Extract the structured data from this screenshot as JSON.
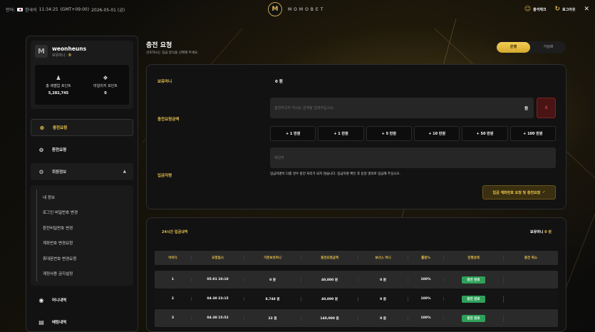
{
  "topbar": {
    "lang_label": "언어:",
    "lang": "한국어",
    "time": "11:34:25",
    "timezone": "(GMT+09:00)",
    "date": "2026-05-01 (금)",
    "logo_letter": "M",
    "brand": "MOMOBET",
    "attendance": "출석체크",
    "logout": "로그아웃",
    "close": "✕"
  },
  "profile": {
    "avatar": "M",
    "username": "weonheuns",
    "level_label": "보유머니 :",
    "level_value": "0",
    "points": [
      {
        "label": "총 레벨업 포인트",
        "value": "5,282,745",
        "icon": "person-icon"
      },
      {
        "label": "마일리지 포인트",
        "value": "0",
        "icon": "mileage-icon"
      }
    ]
  },
  "menu": {
    "deposit": "충전요청",
    "withdraw": "환전요청",
    "member_info": "회원정보",
    "sub": [
      "내 정보",
      "로그인 비밀번호 변경",
      "환전비밀번호 변경",
      "계좌번호 변경요청",
      "휴대폰번호 변경요청",
      "계정사용 금지설정"
    ],
    "money_history": "머니내역",
    "betting_history": "베팅내역"
  },
  "page": {
    "title": "충전 요청",
    "subtitle": "선호하시는 입금 방식을 선택해 주세요.",
    "toggle_on": "은행",
    "toggle_off": "가상화"
  },
  "form": {
    "balance_label": "보유머니",
    "balance_value": "0 원",
    "amount_label": "충전요청금액",
    "amount_placeholder": "충전하고자 하시는 금액을 입력하십시오.",
    "won": "원",
    "clear": "X",
    "amounts": [
      "+ 1 만원",
      "+ 1 만원",
      "+ 5 만원",
      "+ 10 만원",
      "+ 50 만원",
      "+ 100 만원"
    ],
    "depositor_label": "입금자명",
    "depositor_placeholder": "예금주",
    "note": "입금자명이 다를 경우 충전 처리가 되지 않습니다. 입금자명 확인 후 동일 명의로 입금해 주십시오.",
    "submit": "입금 계좌번호 요청 및 충전요청",
    "submit_icon": "✓"
  },
  "history": {
    "title": "24시간 입금내역",
    "balance_label": "보유머니",
    "balance_value": "0 원",
    "headers": [
      "아이디",
      "요청일시",
      "기존보유머니",
      "충전요청금액",
      "보너스 머니",
      "롤링%",
      "진행상태",
      "충전 취소"
    ],
    "rows": [
      {
        "id": "1",
        "date": "05-01 10:10",
        "prev": "0 원",
        "amount": "40,000 원",
        "bonus": "0 원",
        "rolling": "100%",
        "status": "충전 완료",
        "cancel": ""
      },
      {
        "id": "2",
        "date": "04-30 23:15",
        "prev": "8,748 원",
        "amount": "40,000 원",
        "bonus": "0 원",
        "rolling": "100%",
        "status": "충전 완료",
        "cancel": ""
      },
      {
        "id": "3",
        "date": "04-30 15:52",
        "prev": "22 원",
        "amount": "140,000 원",
        "bonus": "0 원",
        "rolling": "100%",
        "status": "충전 완료",
        "cancel": ""
      }
    ]
  }
}
